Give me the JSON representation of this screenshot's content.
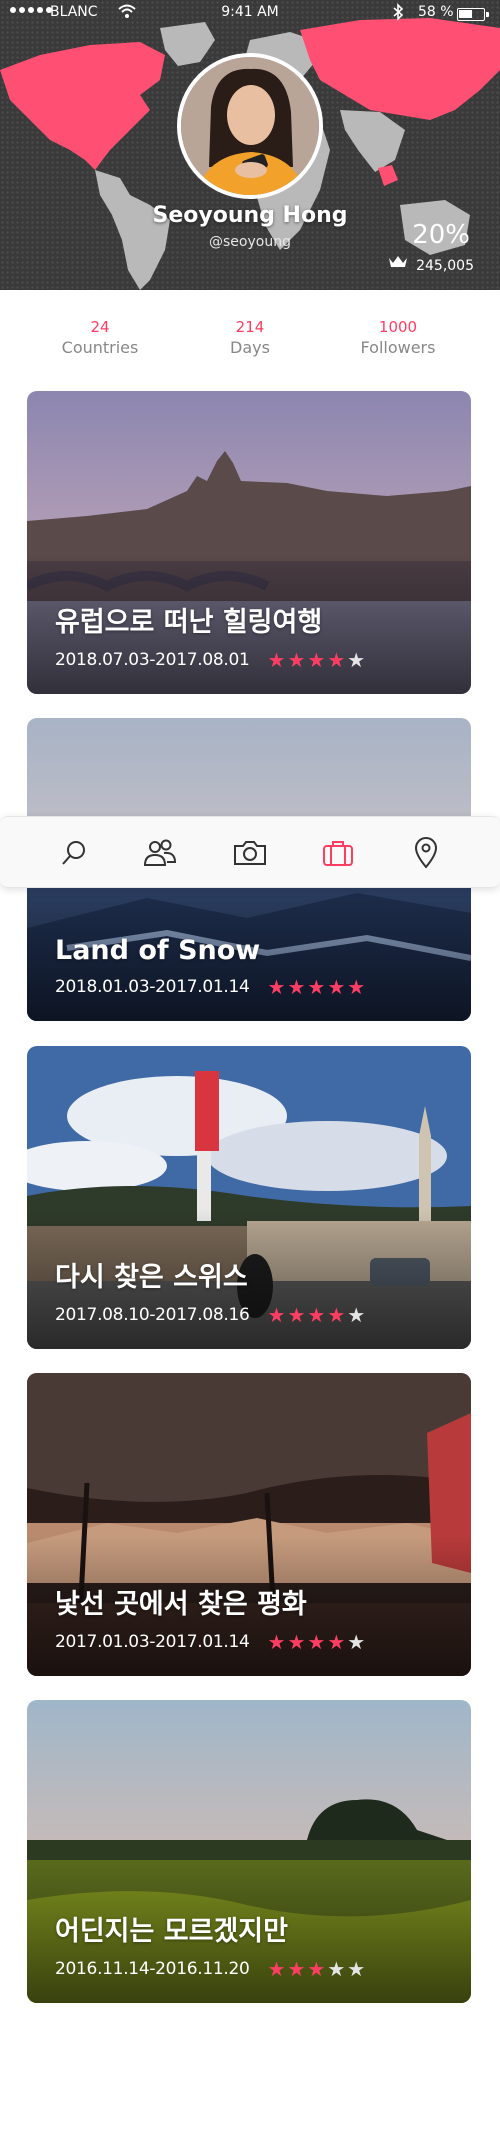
{
  "status_bar": {
    "carrier": "BLANC",
    "time": "9:41 AM",
    "battery": "58 %",
    "battery_level": 0.58
  },
  "profile": {
    "name": "Seoyoung Hong",
    "handle": "@seoyoung",
    "percent": "20%",
    "score": "245,005",
    "rank_icon": "crown-icon"
  },
  "stats": [
    {
      "value": "24",
      "label": "Countries"
    },
    {
      "value": "214",
      "label": "Days"
    },
    {
      "value": "1000",
      "label": "Followers"
    }
  ],
  "tabbar": {
    "items": [
      "search-icon",
      "people-icon",
      "camera-icon",
      "suitcase-icon",
      "location-pin-icon"
    ],
    "active": "suitcase-icon",
    "accent": "#ff3d63"
  },
  "trips": [
    {
      "title": "유럽으로 떠난 힐링여행",
      "dates": "2018.07.03-2017.08.01",
      "rating": 4
    },
    {
      "title": "Land of Snow",
      "dates": "2018.01.03-2017.01.14",
      "rating": 5
    },
    {
      "title": "다시 찾은 스위스",
      "dates": "2017.08.10-2017.08.16",
      "rating": 4
    },
    {
      "title": "낯선 곳에서 찾은 평화",
      "dates": "2017.01.03-2017.01.14",
      "rating": 4
    },
    {
      "title": "어딘지는 모르겠지만",
      "dates": "2016.11.14-2016.11.20",
      "rating": 3
    }
  ],
  "colors": {
    "accent": "#ff3d63",
    "map_visited": "#ff4f73",
    "map_land": "#b9b9b9",
    "header_bg": "#3a3a3a"
  }
}
